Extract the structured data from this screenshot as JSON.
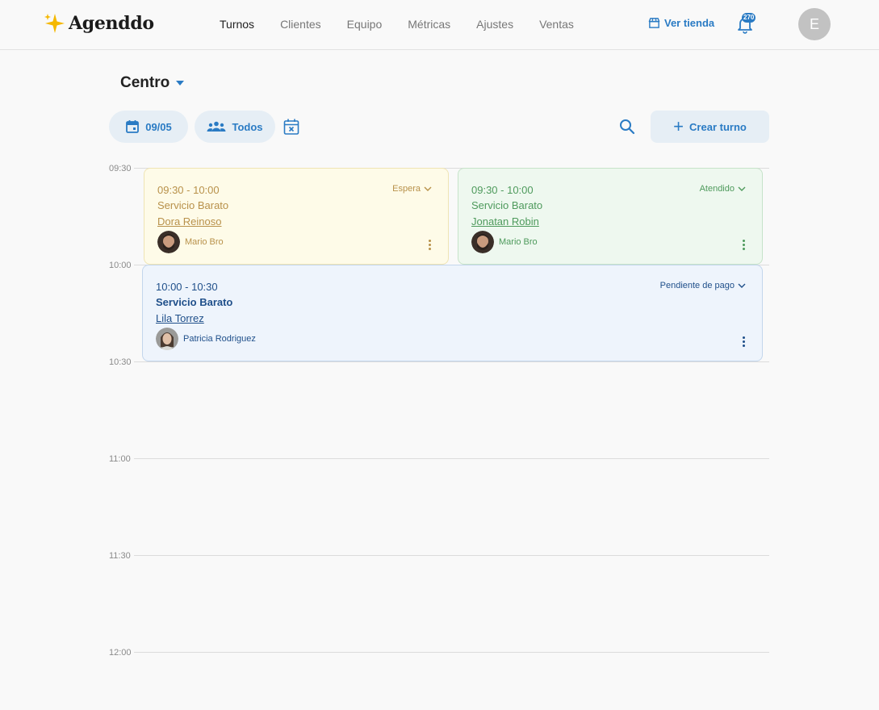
{
  "brand": {
    "name": "Agenddo"
  },
  "nav": {
    "items": [
      "Turnos",
      "Clientes",
      "Equipo",
      "Métricas",
      "Ajustes",
      "Ventas"
    ],
    "active": "Turnos"
  },
  "header": {
    "store_link": "Ver tienda",
    "notification_count": "270",
    "user_initial": "E"
  },
  "location": {
    "name": "Centro"
  },
  "toolbar": {
    "date": "09/05",
    "staff_filter": "Todos",
    "create_label": "Crear turno"
  },
  "timeline": {
    "slots": [
      "09:30",
      "10:00",
      "10:30",
      "11:00",
      "11:30",
      "12:00"
    ]
  },
  "appointments": [
    {
      "time": "09:30 - 10:00",
      "service": "Servicio Barato",
      "client": "Dora Reinoso",
      "staff": "Mario Bro",
      "status": "Espera"
    },
    {
      "time": "09:30 - 10:00",
      "service": "Servicio Barato",
      "client": "Jonatan Robin",
      "staff": "Mario Bro",
      "status": "Atendido"
    },
    {
      "time": "10:00 - 10:30",
      "service": "Servicio Barato",
      "client": "Lila Torrez",
      "staff": "Patricia Rodriguez",
      "status": "Pendiente de pago"
    }
  ],
  "colors": {
    "accent": "#2a7bc4",
    "espera": "#b8914a",
    "atendido": "#4e9a5c",
    "pendiente": "#1f4f8a"
  },
  "icons": [
    "sparkle-logo-icon",
    "store-icon",
    "bell-icon",
    "calendar-icon",
    "people-icon",
    "calendar-x-icon",
    "search-icon",
    "plus-icon",
    "chevron-down-icon",
    "kebab-menu-icon"
  ]
}
